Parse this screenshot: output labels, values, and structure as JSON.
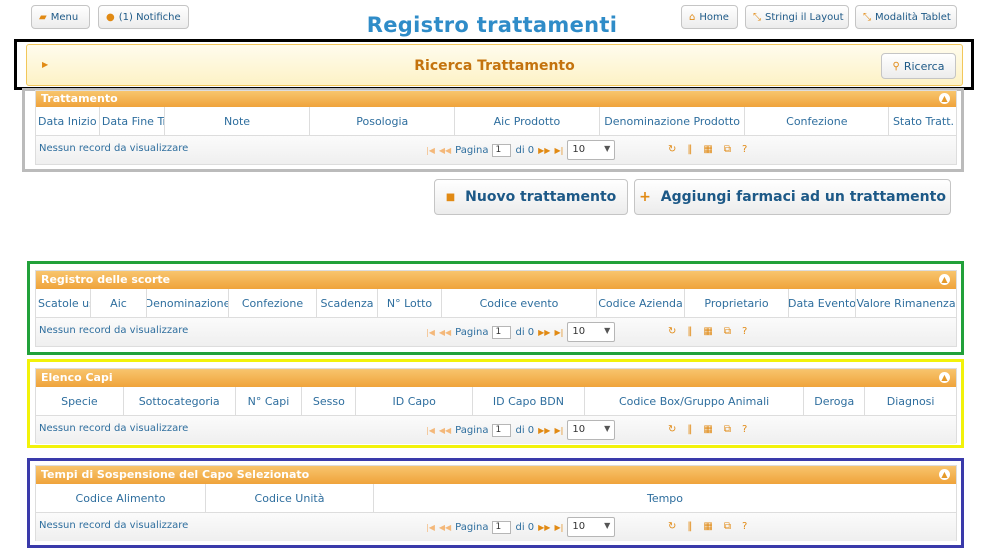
{
  "topbar": {
    "menu_label": "Menu",
    "notifiche_label": "(1) Notifiche",
    "home_label": "Home",
    "stringi_label": "Stringi il Layout",
    "tablet_label": "Modalità Tablet",
    "icons": {
      "menu": "folder-open-icon",
      "notifiche": "bell-icon",
      "home": "home-icon",
      "stringi": "shrink-icon",
      "tablet": "tablet-icon"
    }
  },
  "page_title": "Registro trattamenti",
  "search": {
    "title": "Ricerca Trattamento",
    "button_label": "Ricerca",
    "icon": "search-icon"
  },
  "pager": {
    "empty_message": "Nessun record da visualizzare",
    "page_label": "Pagina",
    "page_value": "1",
    "of_label": "di 0",
    "page_size": "10",
    "icons": [
      "first-icon",
      "prev-icon",
      "next-icon",
      "last-icon",
      "refresh-icon",
      "column-icon",
      "export-icon",
      "copy-icon",
      "help-icon"
    ]
  },
  "trattamento": {
    "title": "Trattamento",
    "columns": [
      "Data Inizio Tratt.",
      "Data Fine Tratt.",
      "Note",
      "Posologia",
      "Aic Prodotto",
      "Denominazione Prodotto",
      "Confezione",
      "Stato Tratt."
    ]
  },
  "actions": {
    "nuovo_label": "Nuovo trattamento",
    "aggiungi_label": "Aggiungi farmaci ad un trattamento"
  },
  "scorte": {
    "title": "Registro delle scorte",
    "columns": [
      "Scatole usate",
      "Aic",
      "Denominazione",
      "Confezione",
      "Scadenza",
      "N° Lotto",
      "Codice evento",
      "Codice Azienda",
      "Proprietario",
      "Data Evento",
      "Valore Rimanenza"
    ]
  },
  "capi": {
    "title": "Elenco Capi",
    "columns": [
      "Specie",
      "Sottocategoria",
      "N° Capi",
      "Sesso",
      "ID Capo",
      "ID Capo BDN",
      "Codice Box/Gruppo Animali",
      "Deroga",
      "Diagnosi"
    ]
  },
  "sospensione": {
    "title": "Tempi di Sospensione del Capo Selezionato",
    "columns": [
      "Codice Alimento",
      "Codice Unità",
      "Tempo"
    ]
  },
  "highlight_colors": {
    "search": "#000000",
    "trattamento": "#bbbbbb",
    "scorte": "#22a13a",
    "capi": "#f2f20a",
    "sospensione": "#3a3aaa"
  },
  "accent": "#f0a43c",
  "title_color": "#2f8cc8"
}
